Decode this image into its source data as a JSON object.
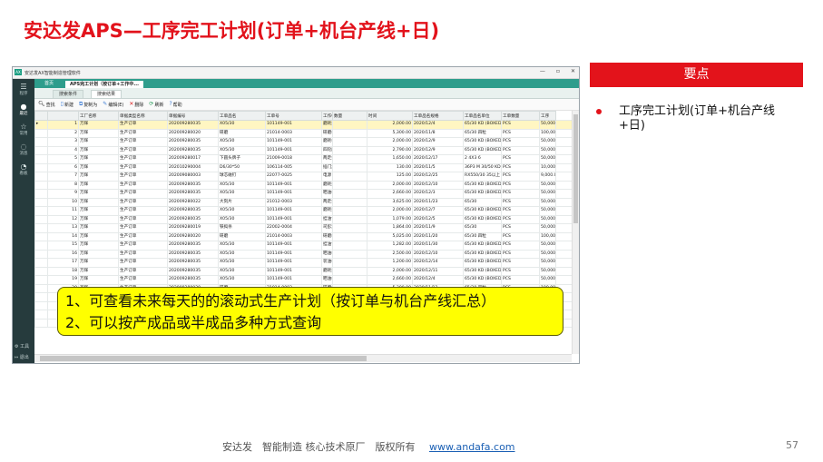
{
  "slide": {
    "title": "安达发APS—工序完工计划(订单+机台产线+日)",
    "keypoints_header": "要点",
    "bullet": "工序完工计划(订单+机台产线+日)",
    "callout_line1": "1、可查看未来每天的的滚动式生产计划（按订单与机台产线汇总）",
    "callout_line2": "2、可以按产成品或半成品多种方式查询",
    "footer_text": "安达发　智能制造 核心技术原厂　版权所有",
    "footer_link": "www.andafa.com",
    "page_number": "57"
  },
  "app": {
    "title": "安达发AX智能制造管理软件",
    "logo": "AX",
    "win_minimize": "—",
    "win_maximize": "▫",
    "win_close": "✕",
    "sidebar": {
      "program": "程序",
      "recent": "最近",
      "favorites": "常用",
      "messages": "消息",
      "dashboard": "看板",
      "tools": "工具",
      "exit": "退出"
    },
    "main_tabs": [
      "首页",
      "APS完工计划（按订单+工作中..."
    ],
    "sub_tabs": [
      "搜索条件",
      "搜索结果"
    ],
    "toolbar": [
      "查找",
      "新建",
      "复制为",
      "编辑(E)",
      "删除",
      "刷新",
      "帮助"
    ],
    "columns": [
      "",
      "工厂名称",
      "单据类型名称",
      "单据编号",
      "工单品名",
      "工单号",
      "工作中心名称",
      "数量",
      "时间",
      "工单品名规格",
      "工单品名单位",
      "工单数量",
      "工序"
    ],
    "rows": [
      [
        "1",
        "万辉",
        "生产订单",
        "202009280035",
        "X05/30",
        "101149-001",
        "磨耗型平角机",
        "",
        "2,000.00",
        "2020/12/4",
        "65/30 KD (BOXED)",
        "PCS",
        "50,000.0000",
        "300"
      ],
      [
        "2",
        "万辉",
        "生产订单",
        "202009280020",
        "研磨",
        "21014-0003",
        "研磨机",
        "",
        "5,300.00",
        "2020/11/8",
        "65/30 四粒",
        "PCS",
        "100,000.0000",
        "500"
      ],
      [
        "3",
        "万辉",
        "生产订单",
        "202009280035",
        "X05/30",
        "101149-001",
        "磨耗机",
        "",
        "2,000.00",
        "2020/12/9",
        "65/30 KD (BOXED)",
        "PCS",
        "50,000.0000",
        "500"
      ],
      [
        "4",
        "万辉",
        "生产订单",
        "202009280035",
        "X05/30",
        "101149-001",
        "四轮磨抛光机",
        "",
        "2,790.00",
        "2020/12/9",
        "65/30 KD (BOXED)",
        "PCS",
        "50,000.0000",
        "500"
      ],
      [
        "5",
        "万辉",
        "生产订单",
        "202009280017",
        "下圆头牌子",
        "21009-0018",
        "两走式研磨抛光机",
        "",
        "1,650.00",
        "2020/12/17",
        "2 4X3 6",
        "PCS",
        "50,000.0000",
        "200"
      ],
      [
        "6",
        "万辉",
        "生产订单",
        "202010290004",
        "D6/30*50",
        "106114-005",
        "插门加包装线",
        "",
        "130.00",
        "2020/11/5",
        "36P3 M 30/50 KD ...",
        "PCS",
        "10,000.0000",
        "1300"
      ],
      [
        "7",
        "万辉",
        "生产订单",
        "202009080003",
        "球芯磁钉",
        "22077-0025",
        "电源",
        "",
        "125.00",
        "2020/12/25",
        "RX550/30 35以上",
        "PCS",
        "9,000.0000",
        "700"
      ],
      [
        "8",
        "万辉",
        "生产订单",
        "202009280035",
        "X05/30",
        "101149-001",
        "磨耗型平角机",
        "",
        "2,000.00",
        "2020/12/10",
        "65/30 KD (BOXED)",
        "PCS",
        "50,000.0000",
        "300"
      ],
      [
        "9",
        "万辉",
        "生产订单",
        "202009280035",
        "X05/30",
        "101149-001",
        "晒油机",
        "",
        "2,660.00",
        "2020/12/3",
        "65/30 KD (BOXED)",
        "PCS",
        "50,000.0000",
        "400"
      ],
      [
        "10",
        "万辉",
        "生产订单",
        "202009280022",
        "大刻片",
        "21012-0003",
        "两走式研磨抛光机",
        "",
        "3,625.00",
        "2020/11/23",
        "65/30",
        "PCS",
        "50,000.0000",
        "200"
      ],
      [
        "11",
        "万辉",
        "生产订单",
        "202009280035",
        "X05/30",
        "101149-001",
        "磨耗型平角机",
        "",
        "2,000.00",
        "2020/12/7",
        "65/30 KD (BOXED)",
        "PCS",
        "50,000.0000",
        "300"
      ],
      [
        "12",
        "万辉",
        "生产订单",
        "202009280035",
        "X05/30",
        "101149-001",
        "挂油包装线",
        "",
        "1,079.00",
        "2020/12/5",
        "65/30 KD (BOXED)",
        "PCS",
        "50,000.0000",
        "600"
      ],
      [
        "13",
        "万辉",
        "生产订单",
        "202009280019",
        "铁捣杀",
        "22002-0004",
        "司彭清压机",
        "",
        "1,864.00",
        "2020/11/9",
        "65/30",
        "PCS",
        "50,000.0000",
        "500"
      ],
      [
        "14",
        "万辉",
        "生产订单",
        "202009280020",
        "研磨",
        "21014-0003",
        "研磨机",
        "",
        "5,025.00",
        "2020/11/20",
        "65/30 四粒",
        "PCS",
        "100,000.0000",
        "500"
      ],
      [
        "15",
        "万辉",
        "生产订单",
        "202009280035",
        "X05/30",
        "101149-001",
        "挂油包装线",
        "",
        "1,282.00",
        "2020/11/30",
        "65/30 KD (BOXED)",
        "PCS",
        "50,000.0000",
        "600"
      ],
      [
        "16",
        "万辉",
        "生产订单",
        "202009280035",
        "X05/30",
        "101149-001",
        "晒油机",
        "",
        "2,500.00",
        "2020/12/10",
        "65/30 KD (BOXED)",
        "PCS",
        "50,000.0000",
        "400"
      ],
      [
        "17",
        "万辉",
        "生产订单",
        "202009280035",
        "X05/30",
        "101149-001",
        "装油机",
        "",
        "1,200.00",
        "2020/12/14",
        "65/30 KD (BOXED)",
        "PCS",
        "50,000.0000",
        "500"
      ],
      [
        "18",
        "万辉",
        "生产订单",
        "202009280035",
        "X05/30",
        "101149-001",
        "磨耗型平角机",
        "",
        "2,000.00",
        "2020/12/11",
        "65/30 KD (BOXED)",
        "PCS",
        "50,000.0000",
        "300"
      ],
      [
        "19",
        "万辉",
        "生产订单",
        "202009280035",
        "X05/30",
        "101149-001",
        "晒油机",
        "",
        "2,660.00",
        "2020/12/4",
        "65/30 KD (BOXED)",
        "PCS",
        "50,000.0000",
        "400"
      ],
      [
        "20",
        "万辉",
        "生产订单",
        "202009280020",
        "研磨",
        "21014-0003",
        "研磨机",
        "",
        "5,300.00",
        "2020/11/12",
        "65/30 四粒",
        "PCS",
        "100,000.0000",
        "500"
      ],
      [
        "21",
        "万辉",
        "生产订单",
        "202009280035",
        "X05/30",
        "101149-001",
        "挂油包装线",
        "",
        "1,282.00",
        "2020/12/1",
        "65/30 KD (BOXED)",
        "PCS",
        "50,000.0000",
        "600"
      ],
      [
        "22",
        "万辉",
        "生产订单",
        "202009280019",
        "铁捣杀",
        "22002-0004",
        "司彭清压机",
        "",
        "1,864.00",
        "2020/11/10",
        "65/30",
        "PCS",
        "50,000.0000",
        "500"
      ],
      [
        "23",
        "万辉",
        "生产订单",
        "202009280022",
        "大刻片",
        "22002-0004",
        "司彭清压机",
        "",
        "1,000.00",
        "2020/11/11",
        "65/30",
        "PCS",
        "50,000.0000",
        "500"
      ],
      [
        "24",
        "万辉",
        "生产订单",
        "202009280024",
        "下圆头牌子",
        "21009-0021",
        "两走式研磨抛光机",
        "",
        "12,000.00",
        "2020/12/1",
        "2 4X5 51",
        "PCS",
        "50,000.0000",
        "200"
      ]
    ]
  }
}
